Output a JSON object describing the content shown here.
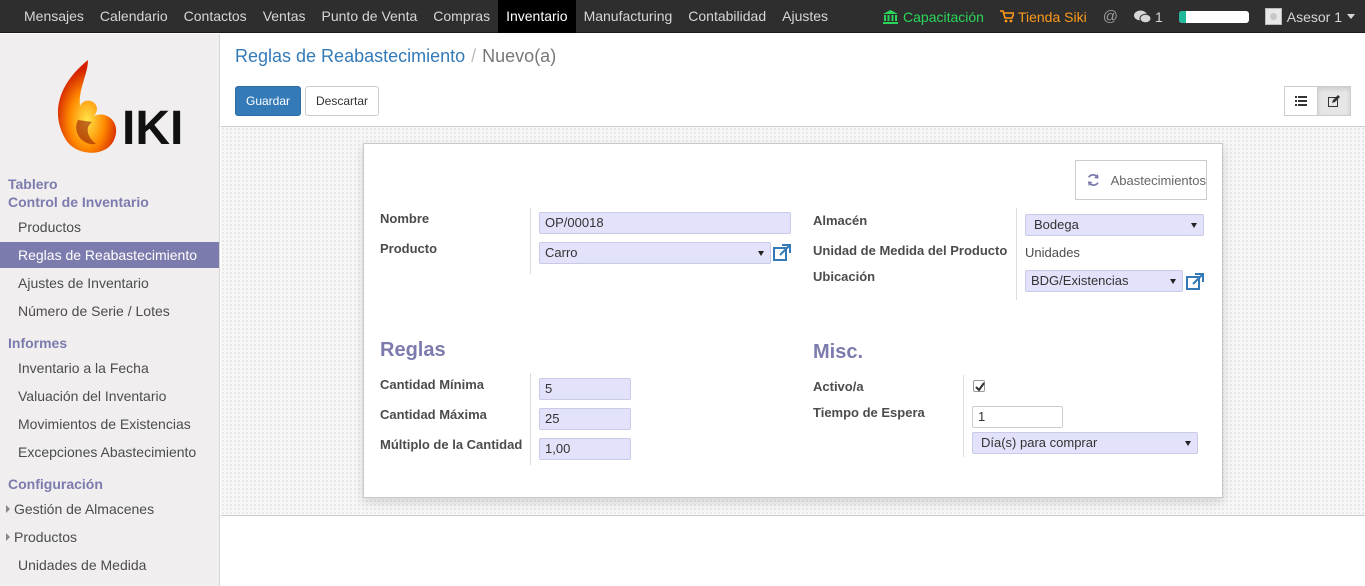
{
  "topbar": {
    "menu": [
      "Mensajes",
      "Calendario",
      "Contactos",
      "Ventas",
      "Punto de Venta",
      "Compras",
      "Inventario",
      "Manufacturing",
      "Contabilidad",
      "Ajustes"
    ],
    "active_menu": "Inventario",
    "capacitacion": "Capacitación",
    "tienda": "Tienda Siki",
    "messages_count": "1",
    "progress": 0.1,
    "user": "Asesor 1"
  },
  "sidebar": {
    "logo_text": "IKI",
    "tablero": "Tablero",
    "control_inventario": "Control de Inventario",
    "items_control": [
      "Productos",
      "Reglas de Reabastecimiento",
      "Ajustes de Inventario",
      "Número de Serie / Lotes"
    ],
    "informes": "Informes",
    "items_informes": [
      "Inventario a la Fecha",
      "Valuación del Inventario",
      "Movimientos de Existencias",
      "Excepciones Abastecimiento"
    ],
    "configuracion": "Configuración",
    "items_config": [
      "Gestión de Almacenes",
      "Productos",
      "Unidades de Medida"
    ]
  },
  "breadcrumb": {
    "parent": "Reglas de Reabastecimiento",
    "current": "Nuevo(a)"
  },
  "buttons": {
    "save": "Guardar",
    "discard": "Descartar"
  },
  "form": {
    "stat_button": "Abastecimientos",
    "nombre_label": "Nombre",
    "nombre_value": "OP/00018",
    "producto_label": "Producto",
    "producto_value": "Carro",
    "almacen_label": "Almacén",
    "almacen_value": "Bodega",
    "uom_label": "Unidad de Medida del Producto",
    "uom_value": "Unidades",
    "ubicacion_label": "Ubicación",
    "ubicacion_value": "BDG/Existencias",
    "reglas_title": "Reglas",
    "cant_min_label": "Cantidad Mínima",
    "cant_min_value": "5",
    "cant_max_label": "Cantidad Máxima",
    "cant_max_value": "25",
    "multiplo_label": "Múltiplo de la Cantidad",
    "multiplo_value": "1,00",
    "misc_title": "Misc.",
    "activo_label": "Activo/a",
    "activo_checked": true,
    "tiempo_label": "Tiempo de Espera",
    "tiempo_value": "1",
    "tiempo_unit": "Día(s) para comprar"
  }
}
